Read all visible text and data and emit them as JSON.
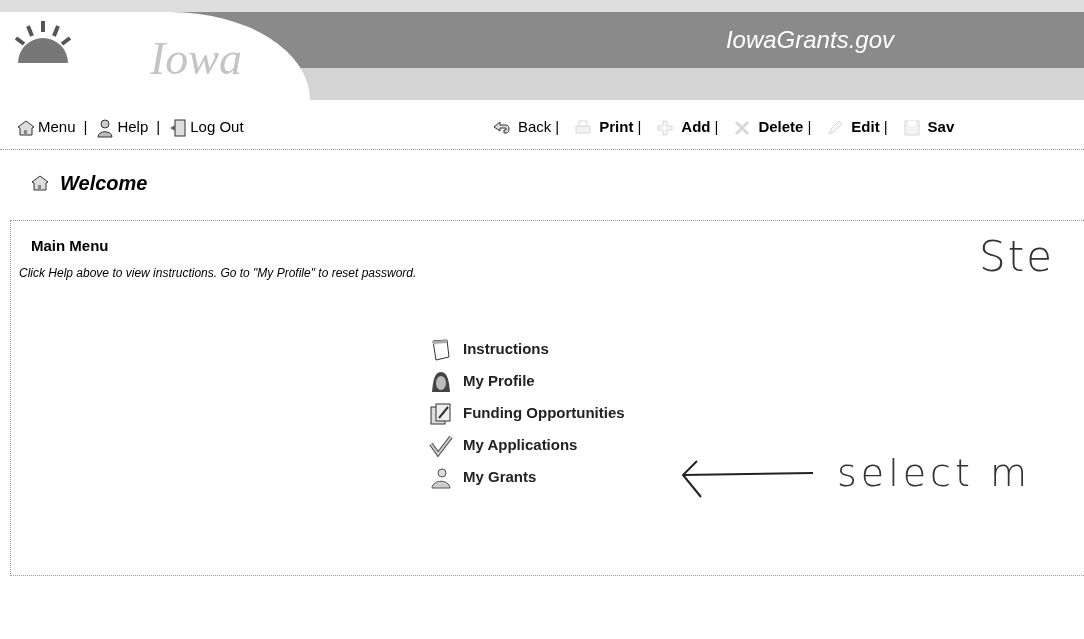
{
  "header": {
    "logo_text": "Iowa",
    "site_title": "IowaGrants.gov"
  },
  "toolbar": {
    "left": [
      {
        "label": "Menu",
        "kind": "home"
      },
      {
        "label": "Help",
        "kind": "person"
      },
      {
        "label": "Log Out",
        "kind": "door"
      }
    ],
    "right": [
      {
        "label": "Back",
        "kind": "back",
        "disabled": false
      },
      {
        "label": "Print",
        "kind": "print",
        "disabled": true
      },
      {
        "label": "Add",
        "kind": "add",
        "disabled": true
      },
      {
        "label": "Delete",
        "kind": "delete",
        "disabled": true
      },
      {
        "label": "Edit",
        "kind": "edit",
        "disabled": true
      },
      {
        "label": "Sav",
        "kind": "save",
        "disabled": true
      }
    ],
    "separator": "|"
  },
  "page_title": "Welcome",
  "panel": {
    "title": "Main Menu",
    "hint": "Click Help above to view instructions. Go to \"My Profile\" to reset password.",
    "items": [
      {
        "label": "Instructions",
        "kind": "note"
      },
      {
        "label": "My Profile",
        "kind": "profile"
      },
      {
        "label": "Funding Opportunities",
        "kind": "papers"
      },
      {
        "label": "My Applications",
        "kind": "check"
      },
      {
        "label": "My Grants",
        "kind": "grants"
      }
    ]
  },
  "annotations": [
    {
      "text": "Ste",
      "kind": "note"
    },
    {
      "text": "select m",
      "kind": "arrow_note"
    }
  ]
}
